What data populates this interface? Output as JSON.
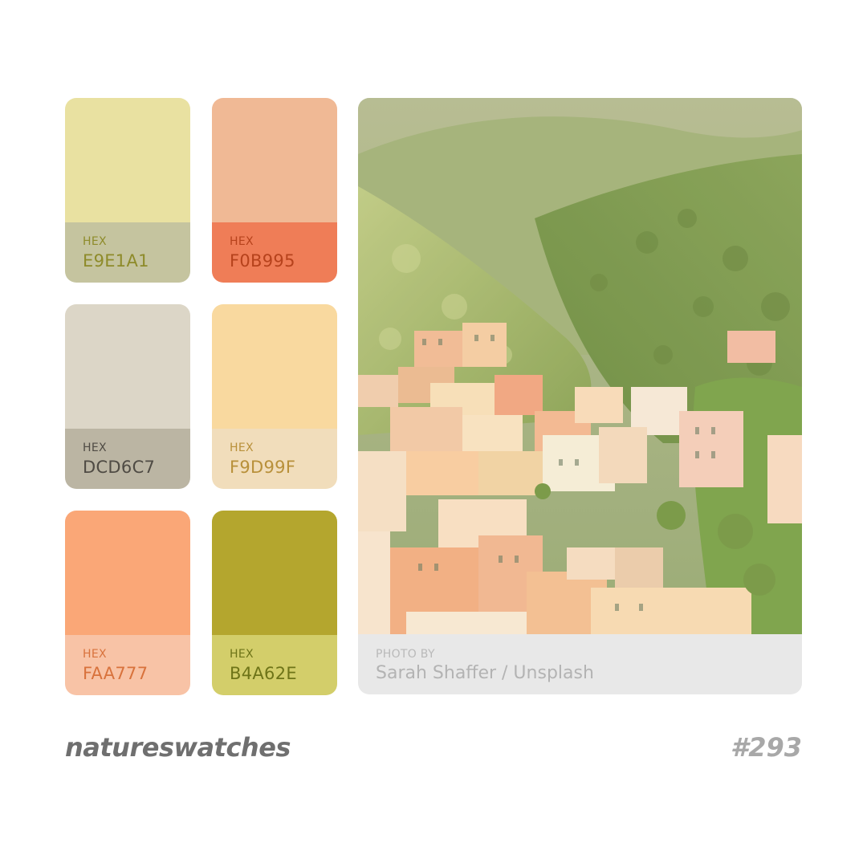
{
  "swatches": [
    {
      "label": "HEX",
      "value": "E9E1A1",
      "color": "#E9E1A1",
      "band": "#C5C49F",
      "text": "#8E8B2A"
    },
    {
      "label": "HEX",
      "value": "F0B995",
      "color": "#F0B995",
      "band": "#EF7D57",
      "text": "#B6421C"
    },
    {
      "label": "HEX",
      "value": "DCD6C7",
      "color": "#DCD6C7",
      "band": "#BBB5A3",
      "text": "#4F4B44"
    },
    {
      "label": "HEX",
      "value": "F9D99F",
      "color": "#F9D99F",
      "band": "#F1DDBB",
      "text": "#B8903A"
    },
    {
      "label": "HEX",
      "value": "FAA777",
      "color": "#FAA777",
      "band": "#F8C3A6",
      "text": "#D8723C"
    },
    {
      "label": "HEX",
      "value": "B4A62E",
      "color": "#B4A62E",
      "band": "#D3CE6A",
      "text": "#6E7418"
    }
  ],
  "photo": {
    "credit_label": "PHOTO BY",
    "credit": "Sarah Shaffer / Unsplash"
  },
  "footer": {
    "brand": "natureswatches",
    "issue": "#293"
  }
}
